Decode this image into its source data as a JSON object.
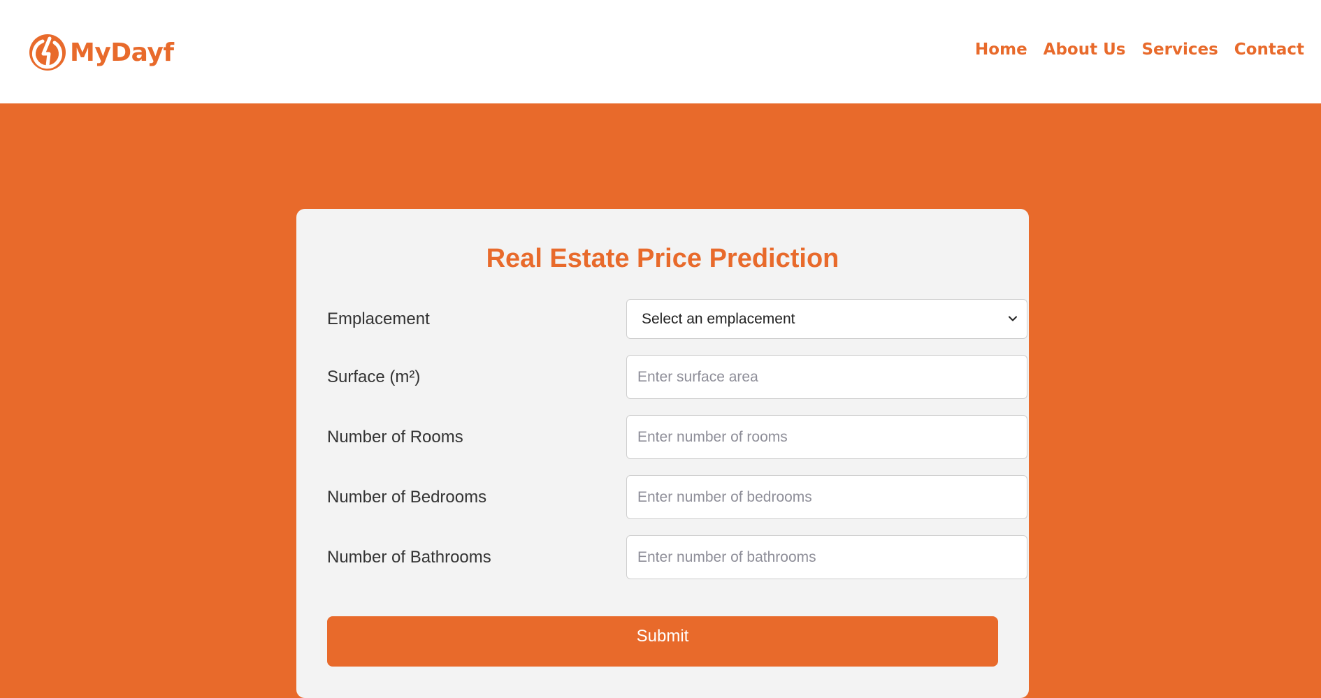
{
  "brand": {
    "name": "MyDayf",
    "color": "#e86a2b"
  },
  "nav": {
    "items": [
      "Home",
      "About Us",
      "Services",
      "Contact"
    ]
  },
  "form": {
    "title": "Real Estate Price Prediction",
    "fields": [
      {
        "label": "Emplacement",
        "type": "select",
        "value": "Select an emplacement"
      },
      {
        "label": "Surface (m²)",
        "type": "input",
        "placeholder": "Enter surface area"
      },
      {
        "label": "Number of Rooms",
        "type": "input",
        "placeholder": "Enter number of rooms"
      },
      {
        "label": "Number of Bedrooms",
        "type": "input",
        "placeholder": "Enter number of bedrooms"
      },
      {
        "label": "Number of Bathrooms",
        "type": "input",
        "placeholder": "Enter number of bathrooms"
      }
    ],
    "submit_label": "Submit"
  },
  "colors": {
    "accent": "#e86a2b",
    "card_background": "#f3f3f3",
    "header_background": "#ffffff"
  },
  "icons": {
    "logo": "power-logo-icon",
    "select": "chevron-down-icon"
  }
}
